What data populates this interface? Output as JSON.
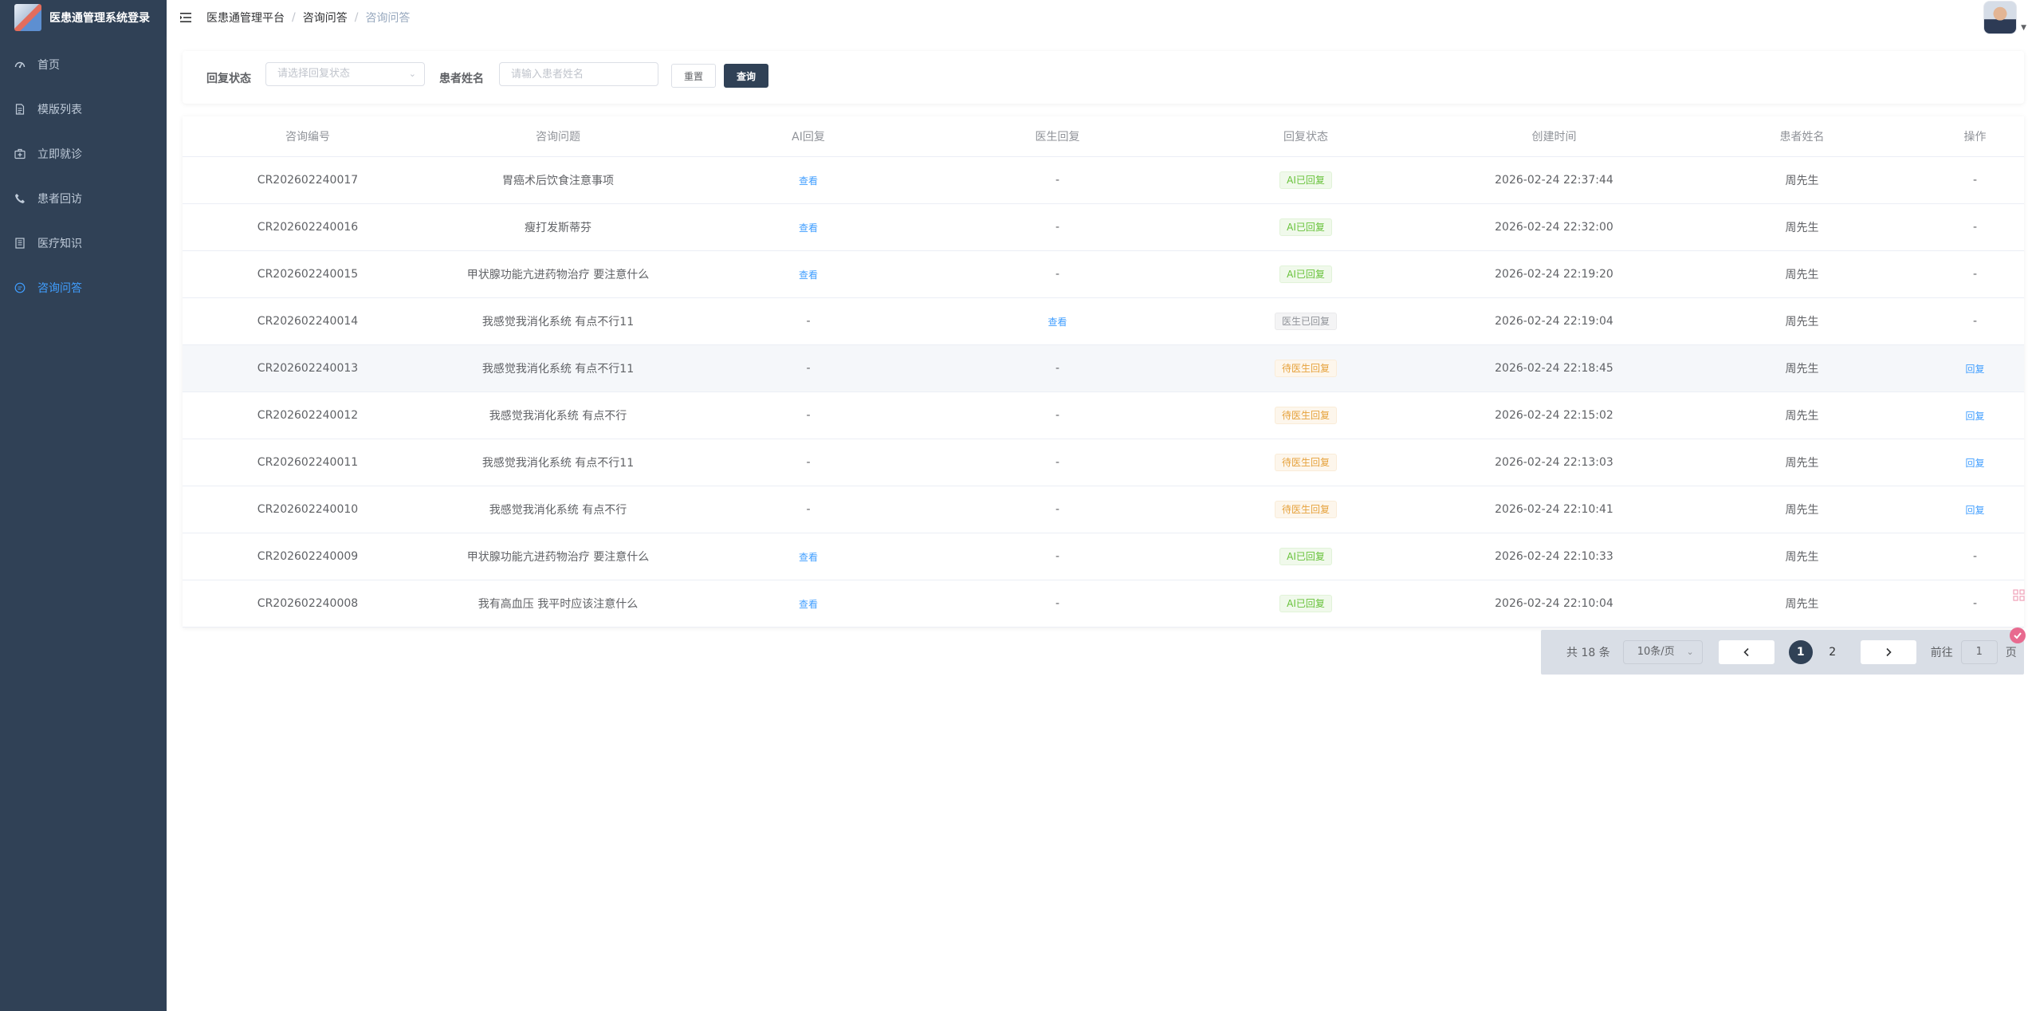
{
  "app": {
    "title": "医患通管理系统登录"
  },
  "sidebar": {
    "items": [
      {
        "label": "首页",
        "icon": "dashboard-icon",
        "active": false
      },
      {
        "label": "模版列表",
        "icon": "document-icon",
        "active": false
      },
      {
        "label": "立即就诊",
        "icon": "medical-kit-icon",
        "active": false
      },
      {
        "label": "患者回访",
        "icon": "phone-icon",
        "active": false
      },
      {
        "label": "医疗知识",
        "icon": "book-icon",
        "active": false
      },
      {
        "label": "咨询问答",
        "icon": "chat-icon",
        "active": true
      }
    ]
  },
  "breadcrumb": [
    "医患通管理平台",
    "咨询问答",
    "咨询问答"
  ],
  "search": {
    "status_label": "回复状态",
    "status_placeholder": "请选择回复状态",
    "name_label": "患者姓名",
    "name_placeholder": "请输入患者姓名",
    "reset_label": "重置",
    "query_label": "查询"
  },
  "table": {
    "columns": [
      "咨询编号",
      "咨询问题",
      "AI回复",
      "医生回复",
      "回复状态",
      "创建时间",
      "患者姓名",
      "操作"
    ],
    "rows": [
      {
        "id": "CR202602240017",
        "question": "胃癌术后饮食注意事项",
        "ai": "查看",
        "doctor": "-",
        "status": "AI已回复",
        "status_type": "ai",
        "time": "2026-02-24 22:37:44",
        "patient": "周先生",
        "op": "-"
      },
      {
        "id": "CR202602240016",
        "question": "瘦打发斯蒂芬",
        "ai": "查看",
        "doctor": "-",
        "status": "AI已回复",
        "status_type": "ai",
        "time": "2026-02-24 22:32:00",
        "patient": "周先生",
        "op": "-"
      },
      {
        "id": "CR202602240015",
        "question": "甲状腺功能亢进药物治疗 要注意什么",
        "ai": "查看",
        "doctor": "-",
        "status": "AI已回复",
        "status_type": "ai",
        "time": "2026-02-24 22:19:20",
        "patient": "周先生",
        "op": "-"
      },
      {
        "id": "CR202602240014",
        "question": "我感觉我消化系统 有点不行11",
        "ai": "-",
        "doctor": "查看",
        "status": "医生已回复",
        "status_type": "doc",
        "time": "2026-02-24 22:19:04",
        "patient": "周先生",
        "op": "-"
      },
      {
        "id": "CR202602240013",
        "question": "我感觉我消化系统 有点不行11",
        "ai": "-",
        "doctor": "-",
        "status": "待医生回复",
        "status_type": "wait",
        "time": "2026-02-24 22:18:45",
        "patient": "周先生",
        "op": "回复"
      },
      {
        "id": "CR202602240012",
        "question": "我感觉我消化系统 有点不行",
        "ai": "-",
        "doctor": "-",
        "status": "待医生回复",
        "status_type": "wait",
        "time": "2026-02-24 22:15:02",
        "patient": "周先生",
        "op": "回复"
      },
      {
        "id": "CR202602240011",
        "question": "我感觉我消化系统 有点不行11",
        "ai": "-",
        "doctor": "-",
        "status": "待医生回复",
        "status_type": "wait",
        "time": "2026-02-24 22:13:03",
        "patient": "周先生",
        "op": "回复"
      },
      {
        "id": "CR202602240010",
        "question": "我感觉我消化系统 有点不行",
        "ai": "-",
        "doctor": "-",
        "status": "待医生回复",
        "status_type": "wait",
        "time": "2026-02-24 22:10:41",
        "patient": "周先生",
        "op": "回复"
      },
      {
        "id": "CR202602240009",
        "question": "甲状腺功能亢进药物治疗 要注意什么",
        "ai": "查看",
        "doctor": "-",
        "status": "AI已回复",
        "status_type": "ai",
        "time": "2026-02-24 22:10:33",
        "patient": "周先生",
        "op": "-"
      },
      {
        "id": "CR202602240008",
        "question": "我有高血压 我平时应该注意什么",
        "ai": "查看",
        "doctor": "-",
        "status": "AI已回复",
        "status_type": "ai",
        "time": "2026-02-24 22:10:04",
        "patient": "周先生",
        "op": "-"
      }
    ]
  },
  "pagination": {
    "total_text": "共 18 条",
    "page_size": "10条/页",
    "pages": [
      "1",
      "2"
    ],
    "current_page": "1",
    "goto_label": "前往",
    "goto_value": "1",
    "page_suffix": "页"
  },
  "colors": {
    "sidebar_bg": "#304156",
    "active": "#409eff",
    "primary_button": "#304156"
  }
}
